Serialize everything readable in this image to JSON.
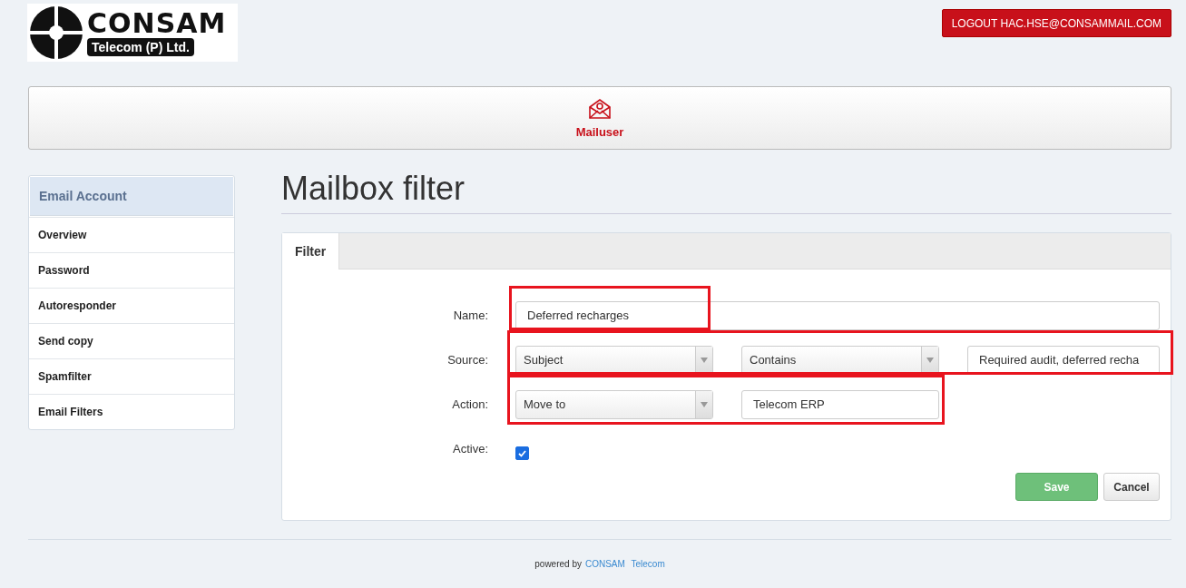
{
  "logo": {
    "title": "CONSAM",
    "subtitle": "Telecom (P) Ltd."
  },
  "logout_button": "LOGOUT HAC.HSE@CONSAMMAIL.COM",
  "nav": [
    {
      "label": "Mailuser",
      "selected": true
    }
  ],
  "sidebar": {
    "header": "Email Account",
    "items": [
      {
        "label": "Overview"
      },
      {
        "label": "Password"
      },
      {
        "label": "Autoresponder"
      },
      {
        "label": "Send copy"
      },
      {
        "label": "Spamfilter"
      },
      {
        "label": "Email Filters"
      }
    ]
  },
  "page_title": "Mailbox filter",
  "tabs": [
    {
      "label": "Filter",
      "selected": true
    }
  ],
  "form": {
    "name": {
      "label": "Name:",
      "value": "Deferred recharges"
    },
    "source": {
      "label": "Source:",
      "field": "Subject",
      "operator": "Contains",
      "value": "Required audit, deferred recha"
    },
    "action": {
      "label": "Action:",
      "type": "Move to",
      "value": "Telecom ERP"
    },
    "active": {
      "label": "Active:",
      "checked": true
    }
  },
  "buttons": {
    "save": "Save",
    "cancel": "Cancel"
  },
  "footer": {
    "prefix": "powered by",
    "brand": "CONSAM",
    "brand2": "Telecom"
  }
}
